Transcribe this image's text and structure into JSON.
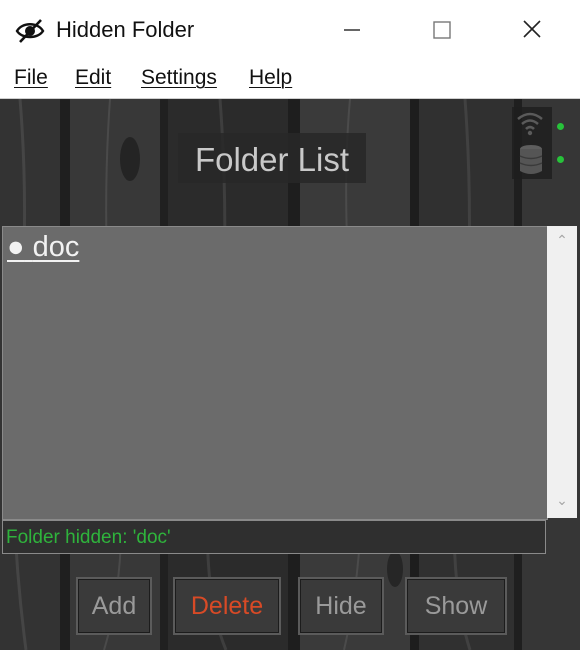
{
  "window": {
    "title": "Hidden Folder"
  },
  "menu": {
    "items": [
      "File",
      "Edit",
      "Settings",
      "Help"
    ]
  },
  "header": {
    "title": "Folder List"
  },
  "folders": [
    {
      "bullet": "●",
      "name": "doc"
    }
  ],
  "status": {
    "message": "Folder hidden: 'doc'",
    "color": "#2fb33c"
  },
  "buttons": {
    "add": "Add",
    "delete": "Delete",
    "hide": "Hide",
    "show": "Show"
  },
  "indicators": {
    "network": "wifi-icon",
    "storage": "database-icon",
    "network_led_color": "#27c23a",
    "storage_led_color": "#27c23a"
  }
}
